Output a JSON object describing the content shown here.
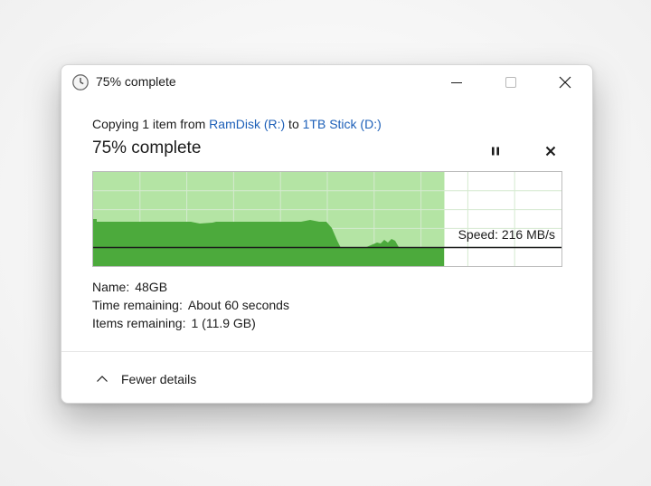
{
  "window": {
    "title": "75% complete",
    "icon": "clock-icon"
  },
  "copy": {
    "prefix": "Copying 1 item from ",
    "source": "RamDisk (R:)",
    "middle": " to ",
    "destination": "1TB Stick (D:)"
  },
  "status": {
    "text": "75% complete",
    "progress": 0.75
  },
  "speed": {
    "label": "Speed: 216 MB/s",
    "value_mb_s": 216
  },
  "details": {
    "name_label": "Name:",
    "name_value": "48GB",
    "time_label": "Time remaining:",
    "time_value": "About 60 seconds",
    "items_label": "Items remaining:",
    "items_value": "1 (11.9 GB)"
  },
  "footer": {
    "toggle_label": "Fewer details",
    "icon": "chevron-up-icon"
  },
  "colors": {
    "progress_fill": "#b4e4a4",
    "speed_fill": "#4caa3c",
    "grid_line": "#d5ead0",
    "link": "#1c5fb8"
  }
}
